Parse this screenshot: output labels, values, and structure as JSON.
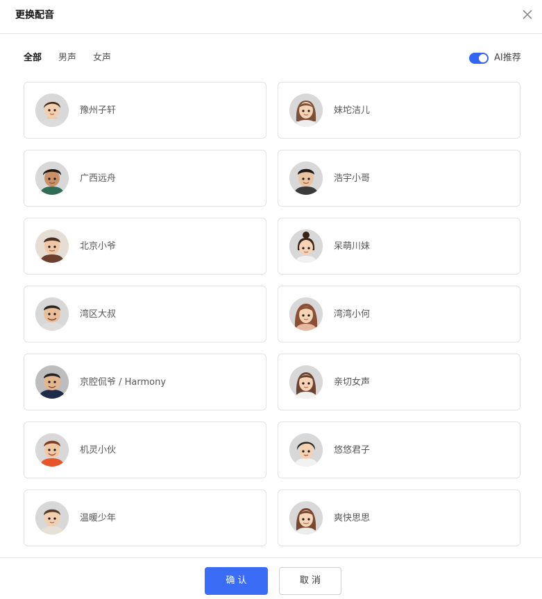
{
  "dialog": {
    "title": "更换配音"
  },
  "filters": {
    "tabs": [
      {
        "label": "全部",
        "active": true
      },
      {
        "label": "男声",
        "active": false
      },
      {
        "label": "女声",
        "active": false
      }
    ],
    "ai_recommend": {
      "label": "AI推荐",
      "enabled": true
    }
  },
  "voices": [
    {
      "name": "豫州子轩",
      "avatar": "boy-avatar-icon"
    },
    {
      "name": "妹坨洁儿",
      "avatar": "girl-avatar-icon"
    },
    {
      "name": "广西远舟",
      "avatar": "boy-avatar-icon"
    },
    {
      "name": "浩宇小哥",
      "avatar": "man-avatar-icon"
    },
    {
      "name": "北京小爷",
      "avatar": "man-avatar-icon"
    },
    {
      "name": "呆萌川妹",
      "avatar": "girl-bun-avatar-icon"
    },
    {
      "name": "湾区大叔",
      "avatar": "uncle-avatar-icon"
    },
    {
      "name": "湾湾小何",
      "avatar": "girl-avatar-icon"
    },
    {
      "name": "京腔侃爷 / Harmony",
      "avatar": "uncle-avatar-icon"
    },
    {
      "name": "亲切女声",
      "avatar": "woman-avatar-icon"
    },
    {
      "name": "机灵小伙",
      "avatar": "boy-avatar-icon"
    },
    {
      "name": "悠悠君子",
      "avatar": "young-man-avatar-icon"
    },
    {
      "name": "温暖少年",
      "avatar": "boy-avatar-icon"
    },
    {
      "name": "爽快思思",
      "avatar": "girl-avatar-icon"
    }
  ],
  "footer": {
    "confirm_label": "确 认",
    "cancel_label": "取 消"
  },
  "colors": {
    "accent": "#3a6cf5",
    "border": "#e2e2e2",
    "text": "#555555"
  }
}
